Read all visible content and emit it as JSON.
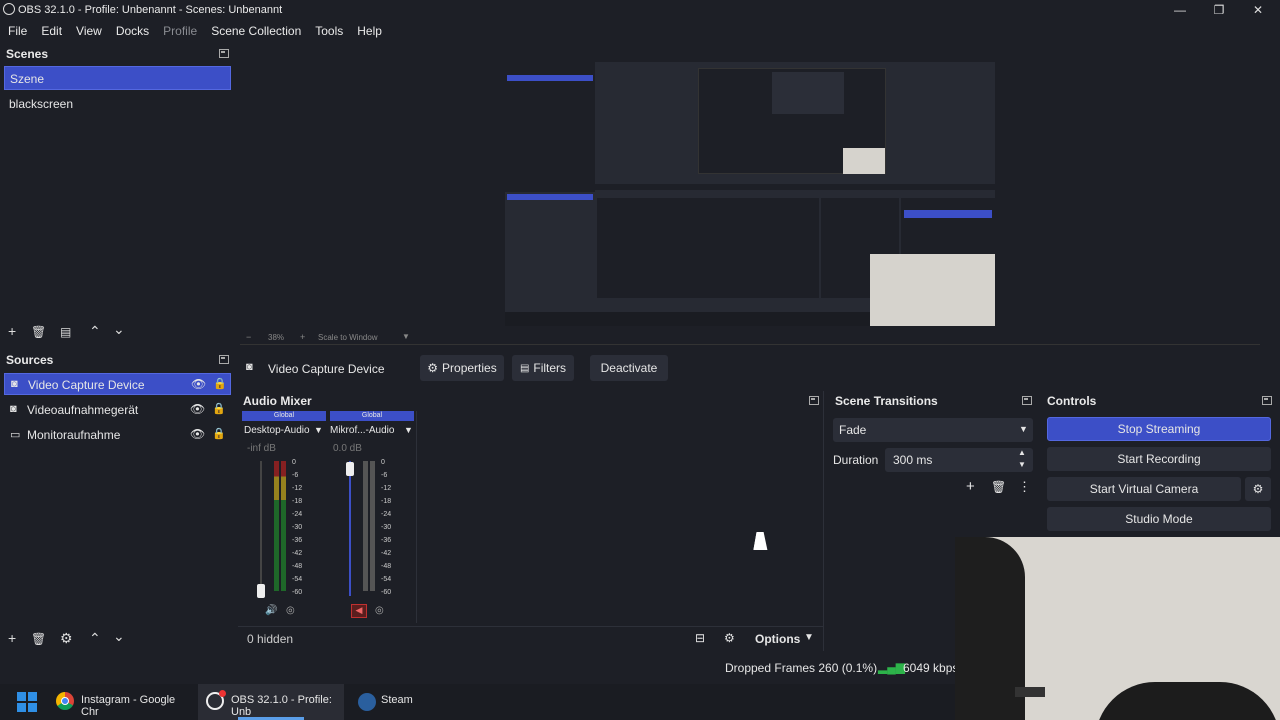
{
  "window": {
    "title": "OBS 32.1.0 - Profile: Unbenannt - Scenes: Unbenannt",
    "controls": {
      "minimize": "—",
      "maximize": "❐",
      "close": "✕"
    }
  },
  "menu": [
    "File",
    "Edit",
    "View",
    "Docks",
    "Profile",
    "Scene Collection",
    "Tools",
    "Help"
  ],
  "scenes": {
    "title": "Scenes",
    "items": [
      "Szene",
      "blackscreen"
    ],
    "selected": "Szene"
  },
  "preview_bar": {
    "zoom": "38%",
    "scale_mode": "Scale to Window"
  },
  "sources": {
    "title": "Sources",
    "items": [
      "Video Capture Device",
      "Videoaufnahmegerät",
      "Monitoraufnahme"
    ],
    "selected": "Video Capture Device"
  },
  "source_toolbar": {
    "name": "Video Capture Device",
    "properties": "Properties",
    "filters": "Filters",
    "deactivate": "Deactivate"
  },
  "audio_mixer": {
    "title": "Audio Mixer",
    "channels": [
      {
        "badge": "Global",
        "name": "Desktop-Audio",
        "level": "-inf dB",
        "muted": false
      },
      {
        "badge": "Global",
        "name": "Mikrof...-Audio",
        "level": "0.0 dB",
        "muted": true
      }
    ],
    "scale": [
      "0",
      "-6",
      "-12",
      "-18",
      "-24",
      "-30",
      "-36",
      "-42",
      "-48",
      "-54",
      "-60"
    ],
    "hidden": "0 hidden",
    "options": "Options"
  },
  "scene_transitions": {
    "title": "Scene Transitions",
    "transition": "Fade",
    "duration_label": "Duration",
    "duration_value": "300 ms"
  },
  "controls": {
    "title": "Controls",
    "stop_streaming": "Stop Streaming",
    "start_recording": "Start Recording",
    "start_virtual_camera": "Start Virtual Camera",
    "studio_mode": "Studio Mode"
  },
  "status": {
    "dropped_frames": "Dropped Frames 260 (0.1%)",
    "bitrate": "6049 kbps"
  },
  "taskbar": {
    "items": [
      "Instagram - Google Chr",
      "OBS 32.1.0 - Profile: Unb",
      "Steam"
    ]
  },
  "colors": {
    "accent": "#3c4fc7",
    "bg": "#1d1f26",
    "panel": "#272a33"
  }
}
